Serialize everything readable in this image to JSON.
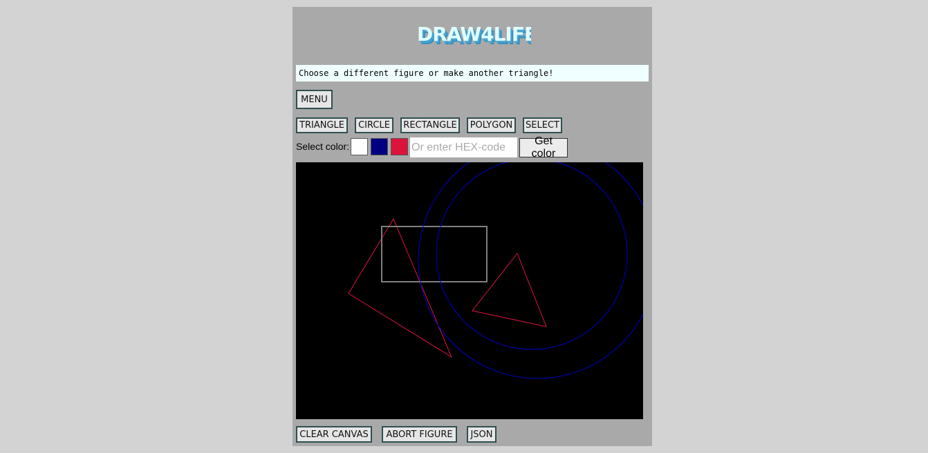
{
  "header": {
    "logo_text": "DRAW4LIFE"
  },
  "status": {
    "message": "Choose a different figure or make another triangle!"
  },
  "menu": {
    "menu_label": "MENU"
  },
  "tools": {
    "triangle_label": "TRIANGLE",
    "circle_label": "CIRCLE",
    "rectangle_label": "RECTANGLE",
    "polygon_label": "POLYGON",
    "select_label": "SELECT"
  },
  "colors": {
    "label": "Select color:",
    "swatches": [
      {
        "name": "white",
        "hex": "#ffffff"
      },
      {
        "name": "navy",
        "hex": "#000080"
      },
      {
        "name": "crimson",
        "hex": "#dc143c"
      }
    ],
    "hex_placeholder": "Or enter HEX-code",
    "hex_value": "",
    "get_color_label": "Get color"
  },
  "canvas": {
    "background": "#000000",
    "shapes": [
      {
        "type": "triangle",
        "color": "#dc143c"
      },
      {
        "type": "rectangle",
        "color": "#808080"
      },
      {
        "type": "triangle",
        "color": "#dc143c"
      },
      {
        "type": "circle",
        "color": "#0000cd"
      },
      {
        "type": "circle",
        "color": "#0000cd"
      }
    ]
  },
  "actions": {
    "clear_label": "CLEAR CANVAS",
    "abort_label": "ABORT FIGURE",
    "json_label": "JSON"
  },
  "theme": {
    "page_bg": "#d3d3d3",
    "panel_bg": "#a9a9a9",
    "status_bg": "#f0ffff",
    "button_border": "#2f4f4f",
    "logo_fill": "#e0ffff",
    "logo_shadow": "#3a8fbf"
  }
}
